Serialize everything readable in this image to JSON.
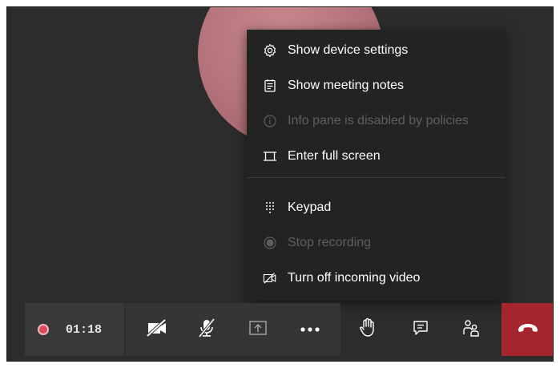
{
  "menu": {
    "items": [
      {
        "label": "Show device settings",
        "icon": "gear-icon",
        "enabled": true
      },
      {
        "label": "Show meeting notes",
        "icon": "notes-icon",
        "enabled": true
      },
      {
        "label": "Info pane is disabled by policies",
        "icon": "info-icon",
        "enabled": false
      },
      {
        "label": "Enter full screen",
        "icon": "fullscreen-icon",
        "enabled": true
      },
      {
        "label": "Keypad",
        "icon": "keypad-icon",
        "enabled": true
      },
      {
        "label": "Stop recording",
        "icon": "record-icon",
        "enabled": false
      },
      {
        "label": "Turn off incoming video",
        "icon": "video-off-icon",
        "enabled": true
      }
    ]
  },
  "toolbar": {
    "recording_time": "01:18",
    "buttons": [
      {
        "name": "camera-off",
        "icon": "video-off-icon"
      },
      {
        "name": "mute",
        "icon": "mic-off-icon"
      },
      {
        "name": "share",
        "icon": "share-tray-icon"
      },
      {
        "name": "more-actions",
        "icon": "more-icon"
      },
      {
        "name": "raise-hand",
        "icon": "hand-icon"
      },
      {
        "name": "chat",
        "icon": "chat-icon"
      },
      {
        "name": "participants",
        "icon": "people-icon"
      },
      {
        "name": "hang-up",
        "icon": "hang-up-icon"
      }
    ]
  },
  "colors": {
    "stage_bg": "#2d2c2c",
    "menu_bg": "#232323",
    "toolbar_bg": "#363535",
    "hangup_bg": "#a4262c",
    "recording_dot": "#e0455a",
    "disabled_text": "#5e5e5e"
  }
}
